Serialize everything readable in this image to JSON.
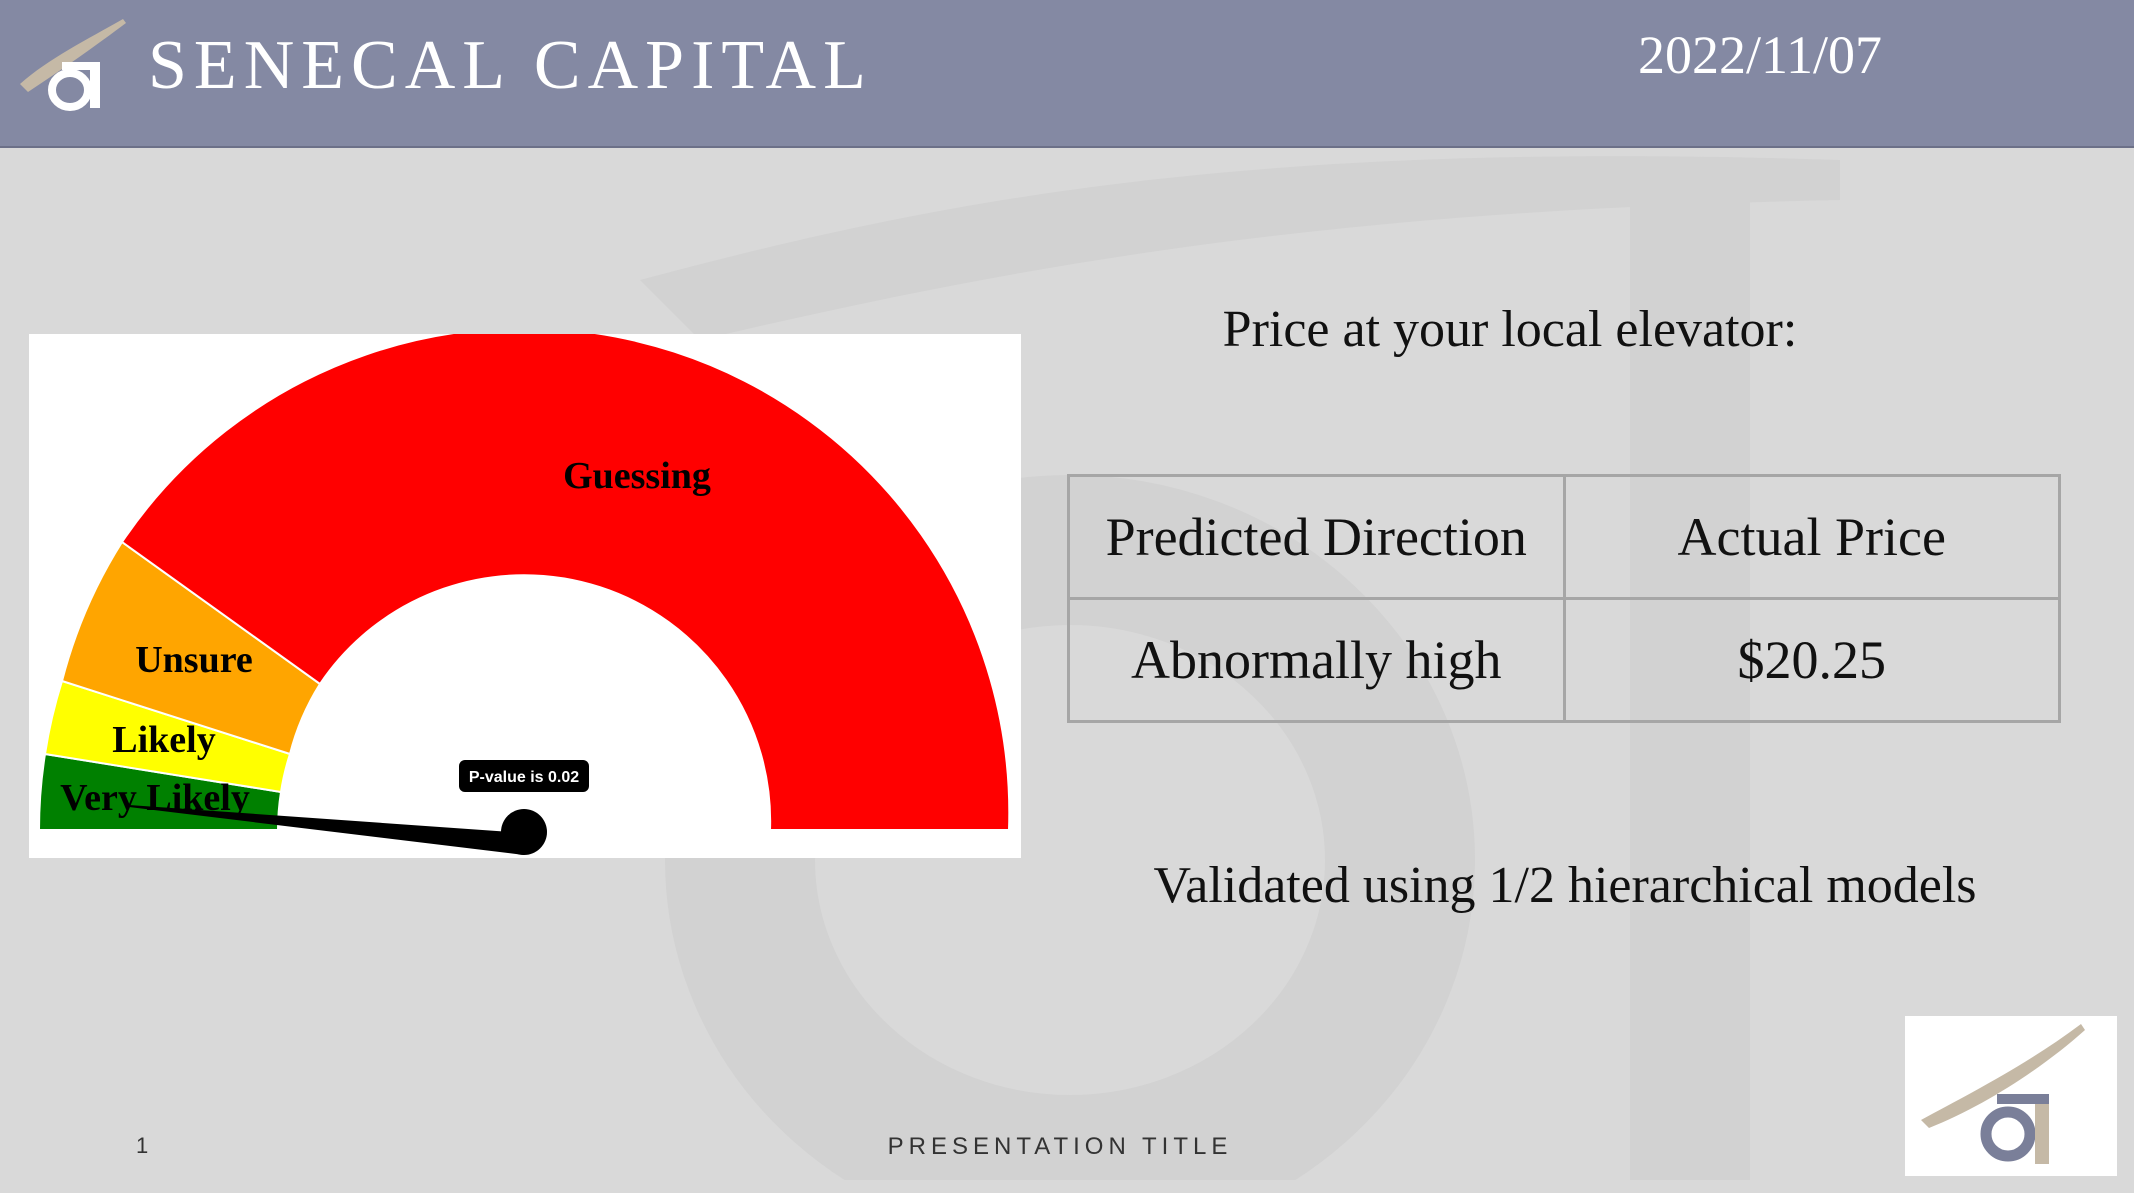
{
  "header": {
    "brand": "SENECAL CAPITAL",
    "date": "2022/11/07"
  },
  "gauge": {
    "zones": [
      {
        "label": "Very Likely",
        "color": "#008000"
      },
      {
        "label": "Likely",
        "color": "#ffff00"
      },
      {
        "label": "Unsure",
        "color": "#ffa500"
      },
      {
        "label": "Guessing",
        "color": "#ff0000"
      }
    ],
    "needle_label": "P-value is 0.02",
    "needle_color": "#000000"
  },
  "right_panel": {
    "heading": "Price at your local elevator:",
    "table": {
      "headers": [
        "Predicted Direction",
        "Actual Price"
      ],
      "rows": [
        [
          "Abnormally high",
          "$20.25"
        ]
      ]
    },
    "validated_text": "Validated using 1/2 hierarchical models"
  },
  "footer": {
    "page_number": "1",
    "title": "PRESENTATION TITLE"
  },
  "colors": {
    "header_bg": "#8489a3",
    "slide_bg": "#d9d9d9",
    "logo_tan": "#c5b9a6",
    "logo_slate": "#7a7f99"
  }
}
